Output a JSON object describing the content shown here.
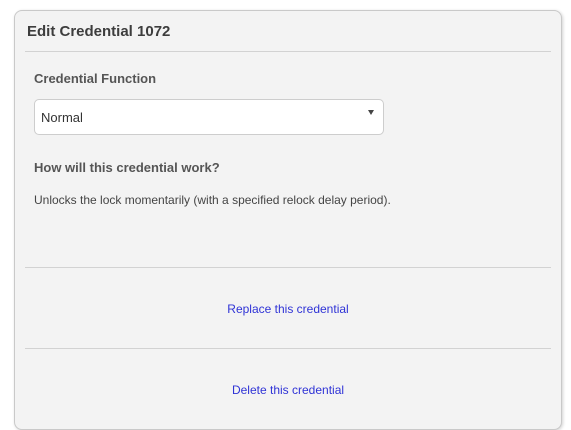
{
  "panel": {
    "title": "Edit Credential 1072"
  },
  "function_field": {
    "label": "Credential Function",
    "selected_value": "Normal"
  },
  "explanation": {
    "question": "How will this credential work?",
    "description": "Unlocks the lock momentarily (with a specified relock delay period)."
  },
  "actions": {
    "replace_label": "Replace this credential",
    "delete_label": "Delete this credential"
  },
  "colors": {
    "link": "#2f33d6",
    "panel_background": "#f3f3f3"
  }
}
